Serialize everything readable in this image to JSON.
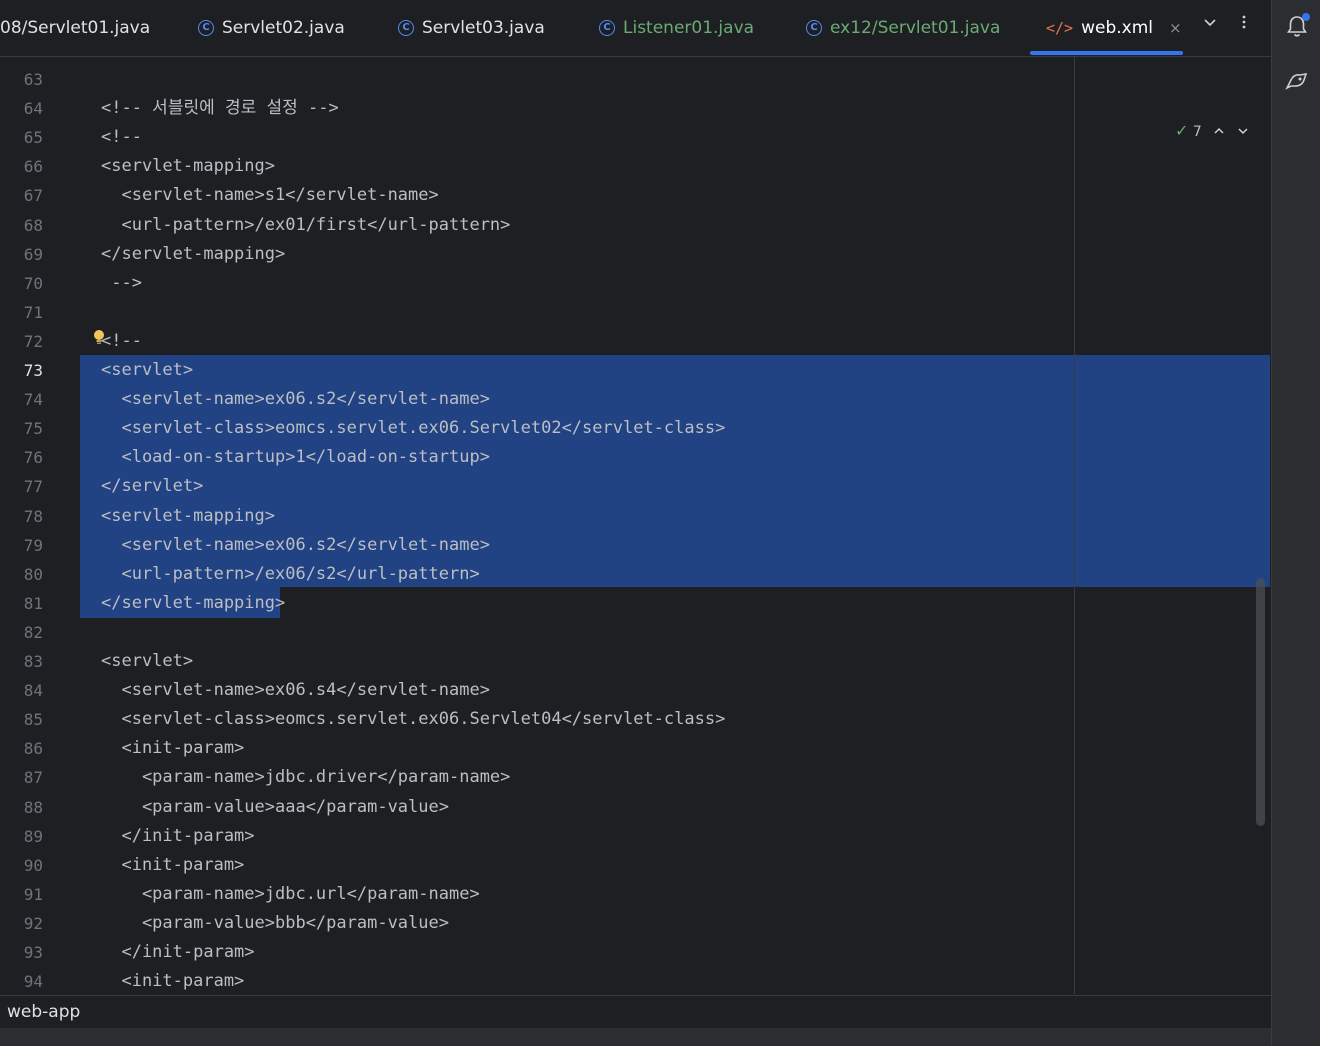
{
  "tabs": [
    {
      "label": "08/Servlet01.java",
      "icon": "class-icon",
      "style": "normal"
    },
    {
      "label": "Servlet02.java",
      "icon": "class-icon",
      "style": "normal"
    },
    {
      "label": "Servlet03.java",
      "icon": "class-icon",
      "style": "normal"
    },
    {
      "label": "Listener01.java",
      "icon": "class-icon",
      "style": "green"
    },
    {
      "label": "ex12/Servlet01.java",
      "icon": "class-icon",
      "style": "green"
    },
    {
      "label": "web.xml",
      "icon": "xml-icon",
      "style": "active"
    }
  ],
  "tab_close_symbol": "×",
  "inspection": {
    "count": "7"
  },
  "breadcrumb": "web-app",
  "editor": {
    "current_line": 73,
    "lines": [
      {
        "n": "63",
        "text": ""
      },
      {
        "n": "64",
        "text": "<!-- 서블릿에 경로 설정 -->"
      },
      {
        "n": "65",
        "text": "<!--"
      },
      {
        "n": "66",
        "text": "<servlet-mapping>"
      },
      {
        "n": "67",
        "text": "  <servlet-name>s1</servlet-name>"
      },
      {
        "n": "68",
        "text": "  <url-pattern>/ex01/first</url-pattern>"
      },
      {
        "n": "69",
        "text": "</servlet-mapping>"
      },
      {
        "n": "70",
        "text": " -->"
      },
      {
        "n": "71",
        "text": ""
      },
      {
        "n": "72",
        "text": "<!--"
      },
      {
        "n": "73",
        "text": "<servlet>"
      },
      {
        "n": "74",
        "text": "  <servlet-name>ex06.s2</servlet-name>"
      },
      {
        "n": "75",
        "text": "  <servlet-class>eomcs.servlet.ex06.Servlet02</servlet-class>"
      },
      {
        "n": "76",
        "text": "  <load-on-startup>1</load-on-startup>"
      },
      {
        "n": "77",
        "text": "</servlet>"
      },
      {
        "n": "78",
        "text": "<servlet-mapping>"
      },
      {
        "n": "79",
        "text": "  <servlet-name>ex06.s2</servlet-name>"
      },
      {
        "n": "80",
        "text": "  <url-pattern>/ex06/s2</url-pattern>"
      },
      {
        "n": "81",
        "text": "</servlet-mapping>"
      },
      {
        "n": "82",
        "text": ""
      },
      {
        "n": "83",
        "text": "<servlet>"
      },
      {
        "n": "84",
        "text": "  <servlet-name>ex06.s4</servlet-name>"
      },
      {
        "n": "85",
        "text": "  <servlet-class>eomcs.servlet.ex06.Servlet04</servlet-class>"
      },
      {
        "n": "86",
        "text": "  <init-param>"
      },
      {
        "n": "87",
        "text": "    <param-name>jdbc.driver</param-name>"
      },
      {
        "n": "88",
        "text": "    <param-value>aaa</param-value>"
      },
      {
        "n": "89",
        "text": "  </init-param>"
      },
      {
        "n": "90",
        "text": "  <init-param>"
      },
      {
        "n": "91",
        "text": "    <param-name>jdbc.url</param-name>"
      },
      {
        "n": "92",
        "text": "    <param-value>bbb</param-value>"
      },
      {
        "n": "93",
        "text": "  </init-param>"
      },
      {
        "n": "94",
        "text": "  <init-param>"
      }
    ]
  }
}
